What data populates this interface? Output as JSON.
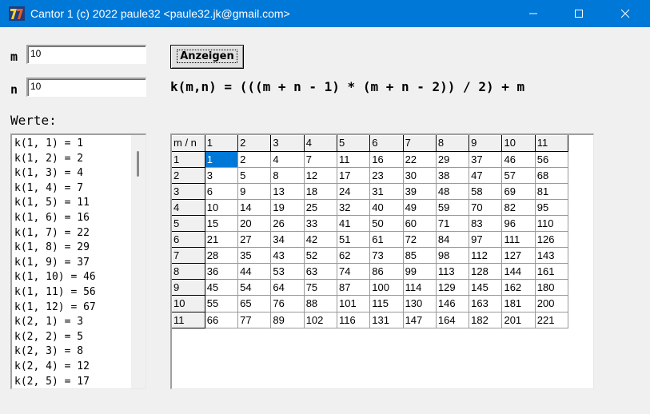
{
  "window": {
    "title": "Cantor 1 (c) 2022 paule32 <paule32.jk@gmail.com>",
    "icon": "delphi-app-icon",
    "accent": "#0078d7"
  },
  "form": {
    "m_label": "m",
    "m_value": "10",
    "n_label": "n",
    "n_value": "10",
    "button_label": "Anzeigen",
    "formula": "k(m,n) = (((m + n - 1) * (m + n - 2)) / 2) + m",
    "werte_label": "Werte:"
  },
  "list": [
    "k(1, 1) = 1",
    "k(1, 2) = 2",
    "k(1, 3) = 4",
    "k(1, 4) = 7",
    "k(1, 5) = 11",
    "k(1, 6) = 16",
    "k(1, 7) = 22",
    "k(1, 8) = 29",
    "k(1, 9) = 37",
    "k(1, 10) = 46",
    "k(1, 11) = 56",
    "k(1, 12) = 67",
    "k(2, 1) = 3",
    "k(2, 2) = 5",
    "k(2, 3) = 8",
    "k(2, 4) = 12",
    "k(2, 5) = 17"
  ],
  "grid": {
    "corner": "m / n",
    "col_headers": [
      "1",
      "2",
      "3",
      "4",
      "5",
      "6",
      "7",
      "8",
      "9",
      "10",
      "11"
    ],
    "row_headers": [
      "1",
      "2",
      "3",
      "4",
      "5",
      "6",
      "7",
      "8",
      "9",
      "10",
      "11"
    ],
    "rows": [
      [
        "1",
        "2",
        "4",
        "7",
        "11",
        "16",
        "22",
        "29",
        "37",
        "46",
        "56"
      ],
      [
        "3",
        "5",
        "8",
        "12",
        "17",
        "23",
        "30",
        "38",
        "47",
        "57",
        "68"
      ],
      [
        "6",
        "9",
        "13",
        "18",
        "24",
        "31",
        "39",
        "48",
        "58",
        "69",
        "81"
      ],
      [
        "10",
        "14",
        "19",
        "25",
        "32",
        "40",
        "49",
        "59",
        "70",
        "82",
        "95"
      ],
      [
        "15",
        "20",
        "26",
        "33",
        "41",
        "50",
        "60",
        "71",
        "83",
        "96",
        "110"
      ],
      [
        "21",
        "27",
        "34",
        "42",
        "51",
        "61",
        "72",
        "84",
        "97",
        "111",
        "126"
      ],
      [
        "28",
        "35",
        "43",
        "52",
        "62",
        "73",
        "85",
        "98",
        "112",
        "127",
        "143"
      ],
      [
        "36",
        "44",
        "53",
        "63",
        "74",
        "86",
        "99",
        "113",
        "128",
        "144",
        "161"
      ],
      [
        "45",
        "54",
        "64",
        "75",
        "87",
        "100",
        "114",
        "129",
        "145",
        "162",
        "180"
      ],
      [
        "55",
        "65",
        "76",
        "88",
        "101",
        "115",
        "130",
        "146",
        "163",
        "181",
        "200"
      ],
      [
        "66",
        "77",
        "89",
        "102",
        "116",
        "131",
        "147",
        "164",
        "182",
        "201",
        "221"
      ]
    ]
  }
}
